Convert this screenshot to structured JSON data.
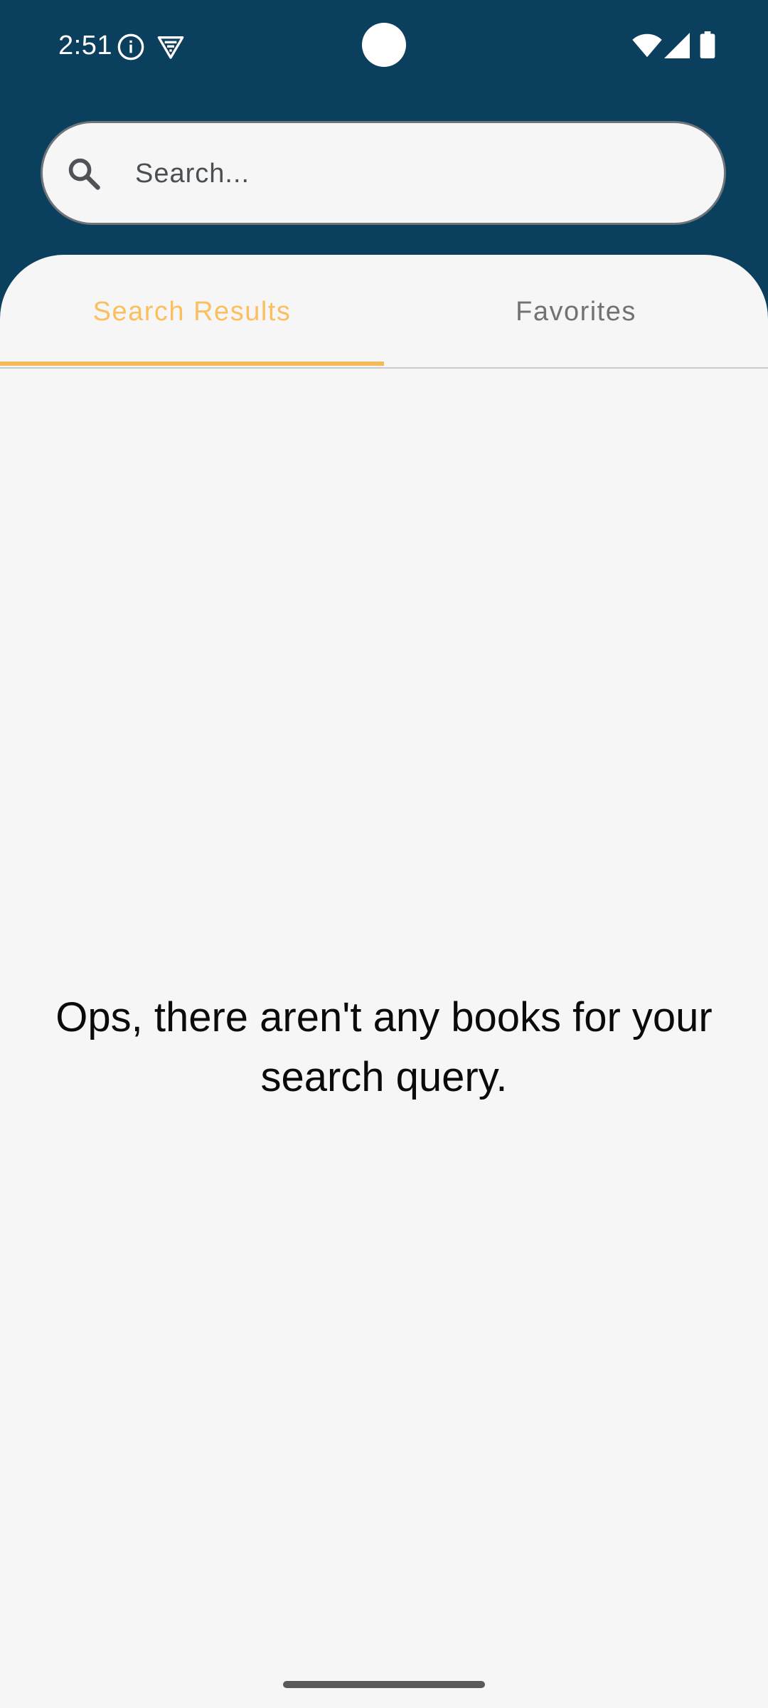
{
  "status_bar": {
    "time": "2:51",
    "icons": [
      "info-icon",
      "vpn-icon",
      "wifi-icon",
      "signal-icon",
      "battery-icon"
    ]
  },
  "search": {
    "placeholder": "Search...",
    "value": "",
    "icon": "search-icon"
  },
  "tabs": [
    {
      "label": "Search Results",
      "selected": true
    },
    {
      "label": "Favorites",
      "selected": false
    }
  ],
  "main": {
    "empty_message": "Ops, there aren't any books for your search query."
  },
  "colors": {
    "header_background": "#0b3f5e",
    "content_background": "#f6f6f6",
    "accent": "#f8b95a",
    "tab_inactive": "#727272"
  }
}
